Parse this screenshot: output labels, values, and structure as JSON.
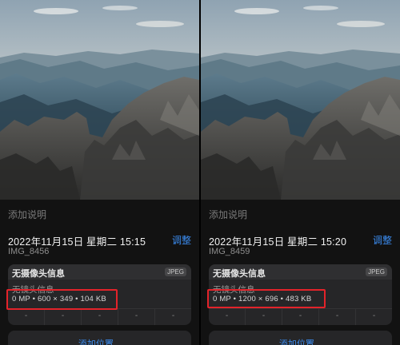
{
  "panels": [
    {
      "caption_placeholder": "添加说明",
      "datetime": "2022年11月15日 星期二 15:15",
      "adjust_label": "调整",
      "filename": "IMG_8456",
      "camera_info": "无摄像头信息",
      "format_badge": "JPEG",
      "lens_info": "无镜头信息",
      "specs": "0 MP • 600 × 349 • 104 KB",
      "exif_cells": [
        "-",
        "-",
        "-",
        "-",
        "-"
      ],
      "location_label": "添加位置..."
    },
    {
      "caption_placeholder": "添加说明",
      "datetime": "2022年11月15日 星期二 15:20",
      "adjust_label": "调整",
      "filename": "IMG_8459",
      "camera_info": "无摄像头信息",
      "format_badge": "JPEG",
      "lens_info": "无镜头信息",
      "specs": "0 MP • 1200 × 696 • 483 KB",
      "exif_cells": [
        "-",
        "-",
        "-",
        "-",
        "-"
      ],
      "location_label": "添加位置..."
    }
  ],
  "colors": {
    "accent": "#3b8cf0",
    "highlight": "#e3232a",
    "background": "#121212",
    "card": "#262628"
  }
}
